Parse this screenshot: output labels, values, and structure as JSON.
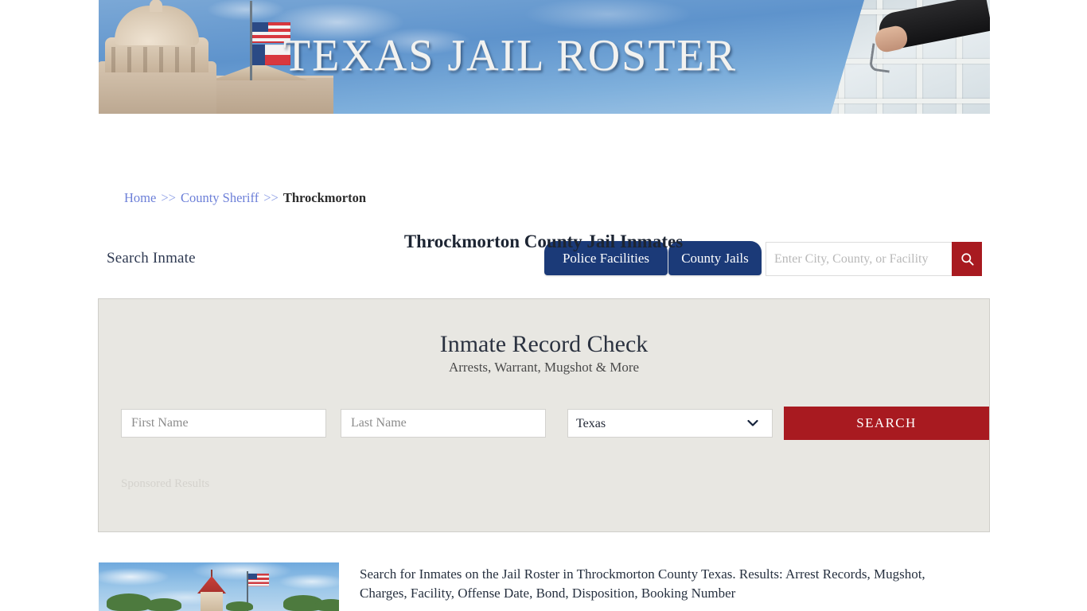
{
  "banner": {
    "title": "TEXAS JAIL ROSTER",
    "left_image": "texas-capitol-photo",
    "right_image": "jail-cell-guard-keys-photo"
  },
  "nav": {
    "brand": "Search Inmate",
    "tabs": [
      {
        "label": "Police Facilities",
        "active": true
      },
      {
        "label": "County Jails",
        "active": false
      }
    ],
    "search": {
      "placeholder": "Enter City, County, or Facility",
      "value": "",
      "button_icon": "search-icon"
    }
  },
  "breadcrumb": {
    "items": [
      {
        "label": "Home",
        "link": true
      },
      {
        "label": "County Sheriff",
        "link": true
      },
      {
        "label": "Throckmorton",
        "link": false
      }
    ],
    "separator": ">>"
  },
  "page_title": "Throckmorton County Jail Inmates",
  "panel": {
    "title": "Inmate Record Check",
    "subtitle": "Arrests, Warrant, Mugshot & More",
    "form": {
      "first_name_placeholder": "First Name",
      "first_name_value": "",
      "last_name_placeholder": "Last Name",
      "last_name_value": "",
      "state_selected": "Texas",
      "state_options": [
        "Texas"
      ],
      "search_button": "SEARCH"
    },
    "sponsored_label": "Sponsored Results"
  },
  "result": {
    "thumbnail": "county-courthouse-photo",
    "text": "Search for Inmates on the Jail Roster in Throckmorton County Texas. Results: Arrest Records, Mugshot, Charges, Facility, Offense Date, Bond, Disposition, Booking Number"
  },
  "colors": {
    "navy": "#1b3a78",
    "crimson": "#a81a20",
    "link_blue": "#6c7fd8",
    "panel_bg": "#e8e7e2"
  }
}
